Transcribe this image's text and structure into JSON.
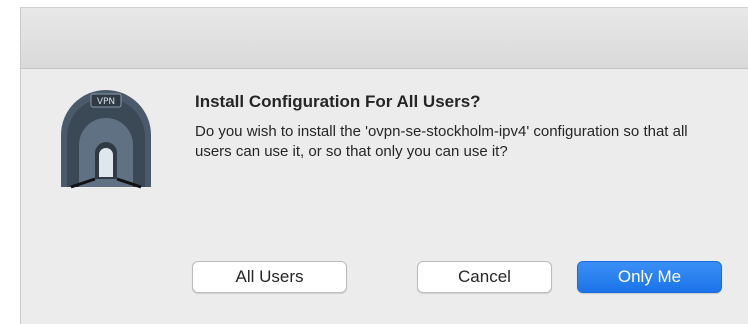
{
  "dialog": {
    "title": "Install Configuration For All Users?",
    "message": "Do you wish to install the 'ovpn-se-stockholm-ipv4' configuration so that all users can use it, or so that only you can use it?",
    "icon": {
      "name": "vpn-tunnel-icon",
      "label": "VPN"
    },
    "buttons": {
      "all_users": "All Users",
      "cancel": "Cancel",
      "only_me": "Only Me"
    },
    "colors": {
      "accent": "#1b73e8",
      "background": "#ececec"
    }
  }
}
